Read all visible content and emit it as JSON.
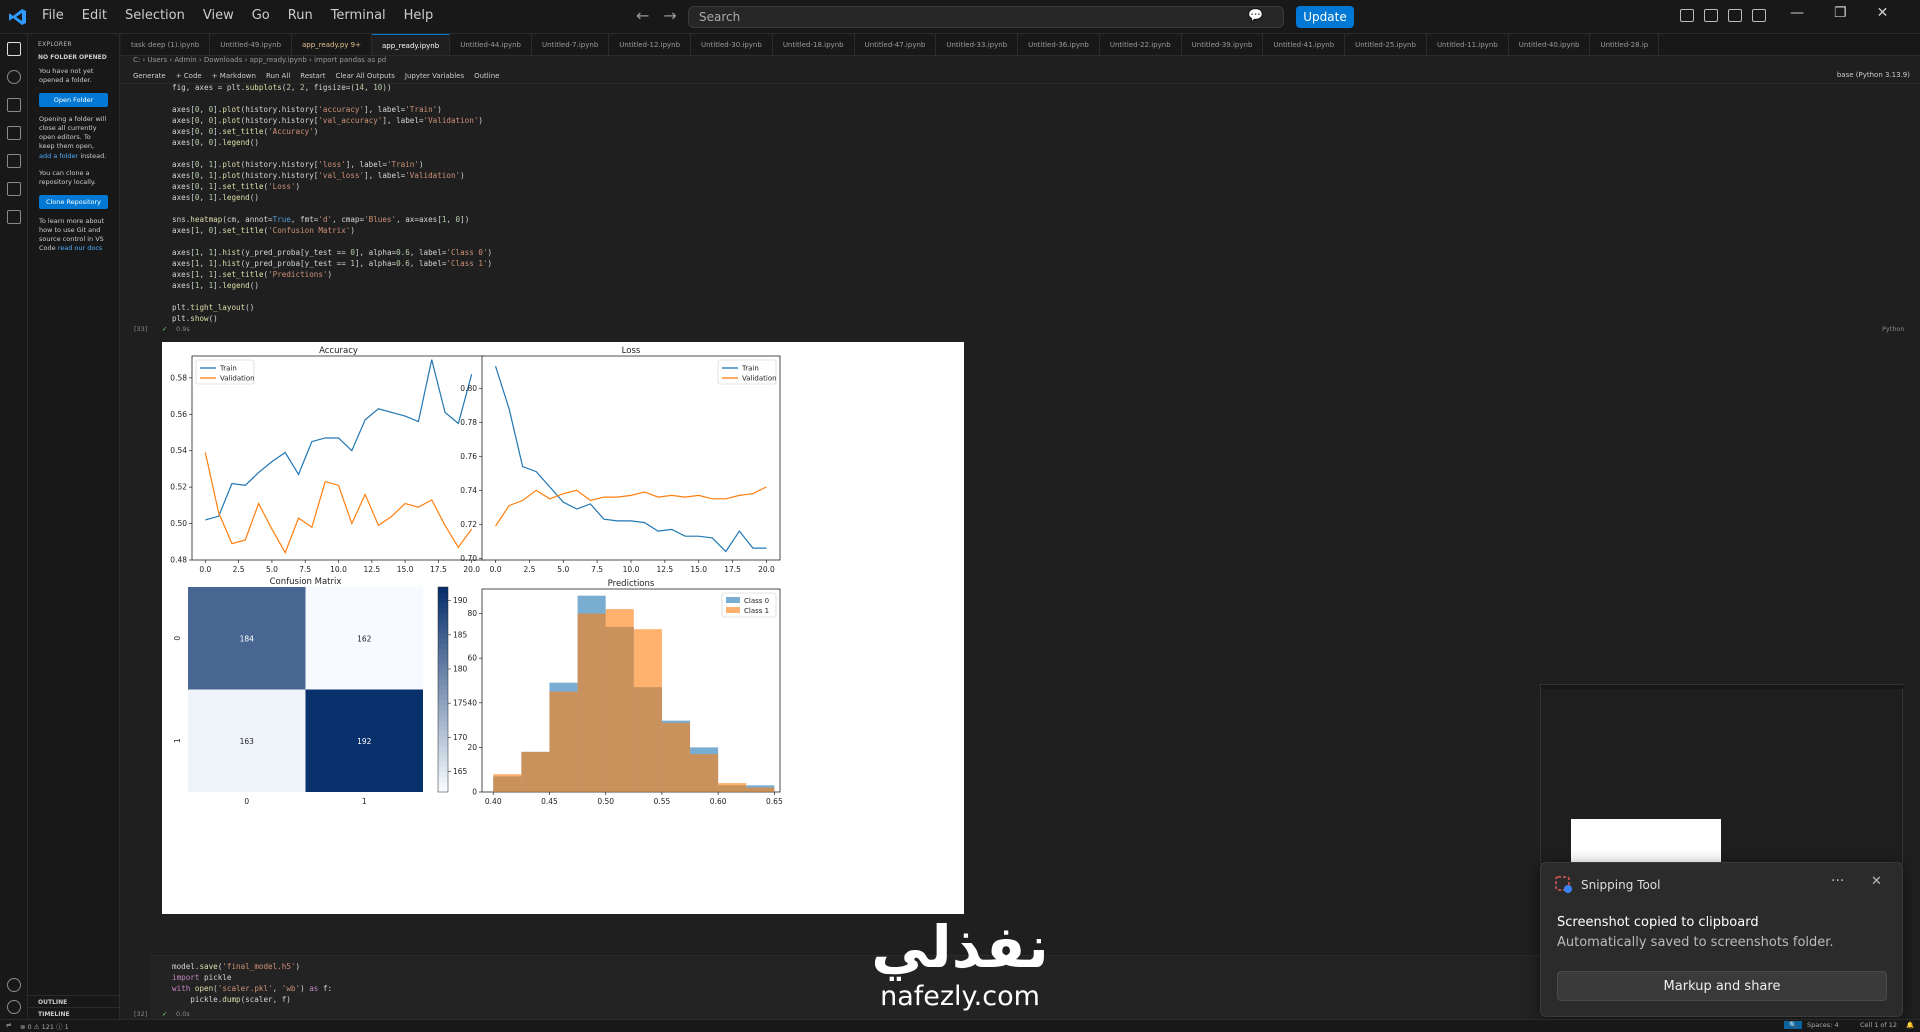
{
  "menu": [
    "File",
    "Edit",
    "Selection",
    "View",
    "Go",
    "Run",
    "Terminal",
    "Help"
  ],
  "search_placeholder": "Search",
  "update_label": "Update",
  "sidebar": {
    "title": "EXPLORER",
    "section": "NO FOLDER OPENED",
    "msg1": "You have not yet opened a folder.",
    "open_folder": "Open Folder",
    "msg2a": "Opening a folder will close all currently open editors. To keep them open,",
    "msg2_link": "add a folder",
    "msg2b": "instead.",
    "msg3": "You can clone a repository locally.",
    "clone_repo": "Clone Repository",
    "msg4a": "To learn more about how to use Git and source control in VS Code",
    "msg4_link": "read our docs",
    "outline": "OUTLINE",
    "timeline": "TIMELINE"
  },
  "tabs": [
    {
      "label": "task deep (1).ipynb",
      "state": "normal"
    },
    {
      "label": "Untitled-49.ipynb",
      "state": "normal"
    },
    {
      "label": "app_ready.py 9+",
      "state": "mod"
    },
    {
      "label": "app_ready.ipynb",
      "state": "active"
    },
    {
      "label": "Untitled-44.ipynb",
      "state": "normal"
    },
    {
      "label": "Untitled-7.ipynb",
      "state": "normal"
    },
    {
      "label": "Untitled-12.ipynb",
      "state": "normal"
    },
    {
      "label": "Untitled-30.ipynb",
      "state": "normal"
    },
    {
      "label": "Untitled-18.ipynb",
      "state": "normal"
    },
    {
      "label": "Untitled-47.ipynb",
      "state": "normal"
    },
    {
      "label": "Untitled-33.ipynb",
      "state": "normal"
    },
    {
      "label": "Untitled-36.ipynb",
      "state": "normal"
    },
    {
      "label": "Untitled-22.ipynb",
      "state": "normal"
    },
    {
      "label": "Untitled-39.ipynb",
      "state": "normal"
    },
    {
      "label": "Untitled-41.ipynb",
      "state": "normal"
    },
    {
      "label": "Untitled-25.ipynb",
      "state": "normal"
    },
    {
      "label": "Untitled-11.ipynb",
      "state": "normal"
    },
    {
      "label": "Untitled-40.ipynb",
      "state": "normal"
    },
    {
      "label": "Untitled-28.ip",
      "state": "normal"
    }
  ],
  "breadcrumb": "C: › Users › Admin › Downloads › app_ready.ipynb › import pandas as pd",
  "toolbar": [
    "Generate",
    "+ Code",
    "+ Markdown",
    "Run All",
    "Restart",
    "Clear All Outputs",
    "Jupyter Variables",
    "Outline"
  ],
  "kernel": "base (Python 3.13.9)",
  "cell1_count": "[33]",
  "cell1_time": "0.9s",
  "cell1_lang": "Python",
  "cell2_count": "[32]",
  "cell2_time": "0.0s",
  "cell1_code": [
    "fig, axes = plt.subplots(2, 2, figsize=(14, 10))",
    "",
    "axes[0, 0].plot(history.history['accuracy'], label='Train')",
    "axes[0, 0].plot(history.history['val_accuracy'], label='Validation')",
    "axes[0, 0].set_title('Accuracy')",
    "axes[0, 0].legend()",
    "",
    "axes[0, 1].plot(history.history['loss'], label='Train')",
    "axes[0, 1].plot(history.history['val_loss'], label='Validation')",
    "axes[0, 1].set_title('Loss')",
    "axes[0, 1].legend()",
    "",
    "sns.heatmap(cm, annot=True, fmt='d', cmap='Blues', ax=axes[1, 0])",
    "axes[1, 0].set_title('Confusion Matrix')",
    "",
    "axes[1, 1].hist(y_pred_proba[y_test == 0], alpha=0.6, label='Class 0')",
    "axes[1, 1].hist(y_pred_proba[y_test == 1], alpha=0.6, label='Class 1')",
    "axes[1, 1].set_title('Predictions')",
    "axes[1, 1].legend()",
    "",
    "plt.tight_layout()",
    "plt.show()"
  ],
  "cell2_code": [
    "model.save('final_model.h5')",
    "import pickle",
    "with open('scaler.pkl', 'wb') as f:",
    "    pickle.dump(scaler, f)"
  ],
  "chart_data": [
    {
      "type": "line",
      "title": "Accuracy",
      "x": [
        0,
        1,
        2,
        3,
        4,
        5,
        6,
        7,
        8,
        9,
        10,
        11,
        12,
        13,
        14,
        15,
        16,
        17,
        18,
        19,
        20
      ],
      "series": [
        {
          "name": "Train",
          "values": [
            0.502,
            0.504,
            0.522,
            0.521,
            0.528,
            0.534,
            0.539,
            0.527,
            0.545,
            0.547,
            0.547,
            0.54,
            0.557,
            0.563,
            0.561,
            0.559,
            0.556,
            0.59,
            0.561,
            0.555,
            0.582
          ]
        },
        {
          "name": "Validation",
          "values": [
            0.539,
            0.506,
            0.489,
            0.491,
            0.511,
            0.497,
            0.484,
            0.503,
            0.498,
            0.523,
            0.521,
            0.5,
            0.516,
            0.499,
            0.504,
            0.511,
            0.509,
            0.513,
            0.499,
            0.487,
            0.497
          ]
        }
      ],
      "xlim": [
        -1,
        21
      ],
      "ylim": [
        0.48,
        0.592
      ],
      "xticks": [
        "0.0",
        "2.5",
        "5.0",
        "7.5",
        "10.0",
        "12.5",
        "15.0",
        "17.5",
        "20.0"
      ],
      "yticks": [
        "0.48",
        "0.50",
        "0.52",
        "0.54",
        "0.56",
        "0.58"
      ],
      "legend": "upper left",
      "colors": [
        "#1f77b4",
        "#ff7f0e"
      ]
    },
    {
      "type": "line",
      "title": "Loss",
      "x": [
        0,
        1,
        2,
        3,
        4,
        5,
        6,
        7,
        8,
        9,
        10,
        11,
        12,
        13,
        14,
        15,
        16,
        17,
        18,
        19,
        20
      ],
      "series": [
        {
          "name": "Train",
          "values": [
            0.813,
            0.788,
            0.754,
            0.751,
            0.742,
            0.733,
            0.729,
            0.732,
            0.723,
            0.722,
            0.722,
            0.721,
            0.716,
            0.717,
            0.713,
            0.713,
            0.712,
            0.704,
            0.716,
            0.706,
            0.706
          ]
        },
        {
          "name": "Validation",
          "values": [
            0.719,
            0.731,
            0.734,
            0.74,
            0.735,
            0.738,
            0.74,
            0.734,
            0.736,
            0.736,
            0.737,
            0.739,
            0.736,
            0.737,
            0.736,
            0.737,
            0.735,
            0.735,
            0.737,
            0.738,
            0.742
          ]
        }
      ],
      "xlim": [
        -1,
        21
      ],
      "ylim": [
        0.699,
        0.819
      ],
      "xticks": [
        "0.0",
        "2.5",
        "5.0",
        "7.5",
        "10.0",
        "12.5",
        "15.0",
        "17.5",
        "20.0"
      ],
      "yticks": [
        "0.70",
        "0.72",
        "0.74",
        "0.76",
        "0.78",
        "0.80"
      ],
      "legend": "upper right",
      "colors": [
        "#1f77b4",
        "#ff7f0e"
      ]
    },
    {
      "type": "heatmap",
      "title": "Confusion Matrix",
      "rows": [
        "0",
        "1"
      ],
      "cols": [
        "0",
        "1"
      ],
      "values": [
        [
          184,
          162
        ],
        [
          163,
          192
        ]
      ],
      "colorbar_ticks": [
        "165",
        "170",
        "175",
        "180",
        "185",
        "190"
      ],
      "colorbar_range": [
        162,
        192
      ],
      "cmap": "Blues"
    },
    {
      "type": "bar",
      "title": "Predictions",
      "bins": [
        [
          0.4,
          0.425
        ],
        [
          0.425,
          0.45
        ],
        [
          0.45,
          0.475
        ],
        [
          0.475,
          0.5
        ],
        [
          0.5,
          0.525
        ],
        [
          0.525,
          0.55
        ],
        [
          0.55,
          0.575
        ],
        [
          0.575,
          0.6
        ],
        [
          0.6,
          0.625
        ],
        [
          0.625,
          0.65
        ]
      ],
      "series": [
        {
          "name": "Class 0",
          "values": [
            7,
            18,
            49,
            88,
            74,
            47,
            32,
            20,
            3,
            3
          ]
        },
        {
          "name": "Class 1",
          "values": [
            8,
            18,
            45,
            80,
            82,
            73,
            31,
            17,
            4,
            2
          ]
        }
      ],
      "xlim": [
        0.39,
        0.655
      ],
      "ylim": [
        0,
        91
      ],
      "xticks": [
        "0.40",
        "0.45",
        "0.50",
        "0.55",
        "0.60",
        "0.65"
      ],
      "yticks": [
        "0",
        "20",
        "40",
        "60",
        "80"
      ],
      "legend": "upper right",
      "colors": [
        "#1f77b4",
        "#ff7f0e"
      ]
    }
  ],
  "toast": {
    "app": "Snipping Tool",
    "line1": "Screenshot copied to clipboard",
    "line2": "Automatically saved to screenshots folder.",
    "button": "Markup and share"
  },
  "watermark": {
    "arabic": "نفذلي",
    "latin": "nafezly.com"
  },
  "statusbar": {
    "left": "⊗ 0 ⚠ 121 ⓘ 1",
    "right1": "Spaces: 4",
    "right2": "Cell 1 of 12"
  }
}
